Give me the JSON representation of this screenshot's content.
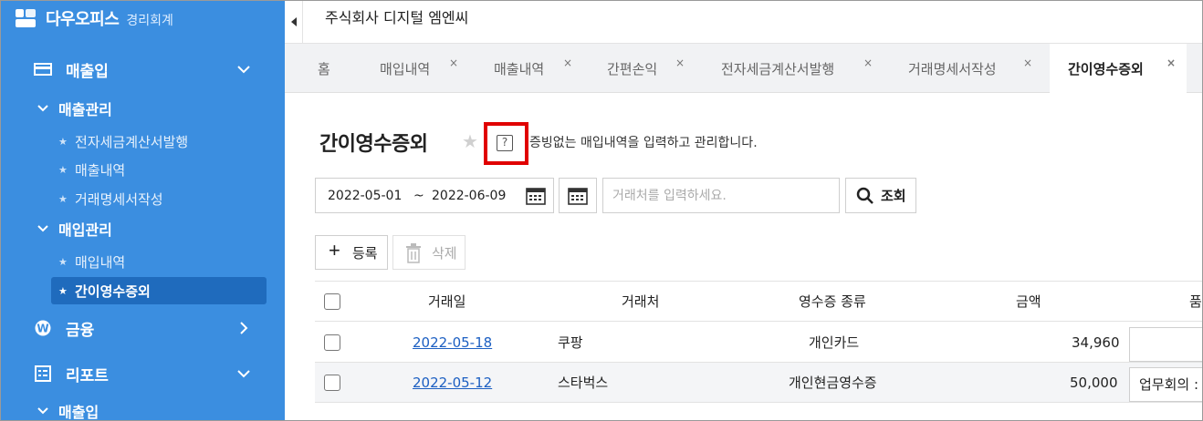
{
  "brand": {
    "name": "다우오피스",
    "sub": "경리회계"
  },
  "sidebar": {
    "groups": [
      {
        "label": "매출입",
        "icon": "card-icon",
        "expanded": true
      },
      {
        "label": "금융",
        "icon": "won-circle-icon",
        "expanded": false
      },
      {
        "label": "리포트",
        "icon": "report-icon",
        "expanded": true
      }
    ],
    "subgroups": [
      {
        "label": "매출관리",
        "expanded": true
      },
      {
        "label": "매입관리",
        "expanded": true
      },
      {
        "label": "매출입",
        "expanded": true
      }
    ],
    "sales_items": [
      "전자세금계산서발행",
      "매출내역",
      "거래명세서작성"
    ],
    "purchase_items": [
      "매입내역",
      "간이영수증외"
    ],
    "active_item": "간이영수증외",
    "colors": {
      "background": "#3b8ee0",
      "active": "#1f6bbd"
    }
  },
  "header": {
    "company": "주식회사 디지털 엠엔씨"
  },
  "tabs": [
    {
      "label": "홈",
      "closable": false,
      "active": false
    },
    {
      "label": "매입내역",
      "closable": true,
      "active": false
    },
    {
      "label": "매출내역",
      "closable": true,
      "active": false
    },
    {
      "label": "간편손익",
      "closable": true,
      "active": false
    },
    {
      "label": "전자세금계산서발행",
      "closable": true,
      "active": false
    },
    {
      "label": "거래명세서작성",
      "closable": true,
      "active": false
    },
    {
      "label": "간이영수증외",
      "closable": true,
      "active": true
    }
  ],
  "tab_close_symbol": "×",
  "page": {
    "title": "간이영수증외",
    "description": "증빙없는 매입내역을 입력하고 관리합니다.",
    "help_symbol": "?"
  },
  "filters": {
    "date_start": "2022-05-01",
    "date_separator": "~",
    "date_end": "2022-06-09",
    "search_placeholder": "거래처를 입력하세요.",
    "search_label": "조회"
  },
  "actions": {
    "add_label": "등록",
    "delete_label": "삭제"
  },
  "table": {
    "columns": [
      "거래일",
      "거래처",
      "영수증 종류",
      "금액",
      "품"
    ],
    "rows": [
      {
        "date": "2022-05-18",
        "vendor": "쿠팡",
        "receipt_type": "개인카드",
        "amount": "34,960",
        "memo": ""
      },
      {
        "date": "2022-05-12",
        "vendor": "스타벅스",
        "receipt_type": "개인현금영수증",
        "amount": "50,000",
        "memo": "업무회의 :"
      }
    ]
  },
  "accent_colors": {
    "link": "#1c5fc2",
    "highlight": "#e00000"
  }
}
